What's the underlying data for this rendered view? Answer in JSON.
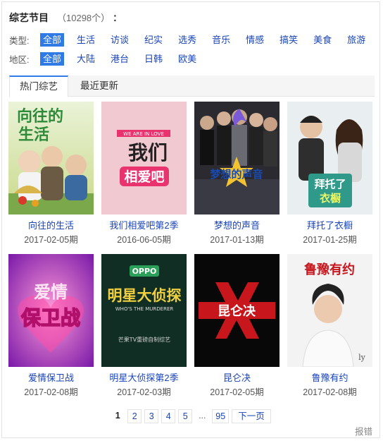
{
  "header": {
    "title": "综艺节目",
    "count": "（10298个）",
    "count_suffix": "："
  },
  "filters": {
    "type": {
      "label": "类型:",
      "options": [
        "全部",
        "生活",
        "访谈",
        "纪实",
        "选秀",
        "音乐",
        "情感",
        "搞笑",
        "美食",
        "旅游"
      ],
      "selected": "全部"
    },
    "region": {
      "label": "地区:",
      "options": [
        "全部",
        "大陆",
        "港台",
        "日韩",
        "欧美"
      ],
      "selected": "全部"
    }
  },
  "tabs": [
    {
      "label": "热门综艺",
      "active": true
    },
    {
      "label": "最近更新",
      "active": false
    }
  ],
  "shows": [
    {
      "name": "向往的生活",
      "date": "2017-02-05期",
      "poster_text": "向往的生活"
    },
    {
      "name": "我们相爱吧第2季",
      "date": "2016-06-05期",
      "poster_text": "我们相爱吧",
      "poster_subtext": "WE ARE IN LOVE"
    },
    {
      "name": "梦想的声音",
      "date": "2017-01-13期",
      "poster_text": "梦想的声音"
    },
    {
      "name": "拜托了衣橱",
      "date": "2017-01-25期",
      "poster_text": "拜托了衣橱"
    },
    {
      "name": "爱情保卫战",
      "date": "2017-02-08期",
      "poster_text": "爱情保卫战"
    },
    {
      "name": "明星大侦探第2季",
      "date": "2017-02-03期",
      "poster_text": "明星大侦探",
      "poster_subtext": "WHO'S THE MURDERER",
      "poster_brand": "OPPO",
      "poster_caption": "芒果TV重磅自制综艺"
    },
    {
      "name": "昆仑决",
      "date": "2017-02-05期",
      "poster_text": "昆仑决"
    },
    {
      "name": "鲁豫有约",
      "date": "2017-02-08期",
      "poster_text": "鲁豫有约"
    }
  ],
  "pagination": {
    "current": "1",
    "pages": [
      "2",
      "3",
      "4",
      "5"
    ],
    "ellipsis": "...",
    "last": "95",
    "next": "下一页"
  },
  "report": "报错",
  "colors": {
    "accent": "#2f7ae5",
    "link": "#1a44b8"
  }
}
